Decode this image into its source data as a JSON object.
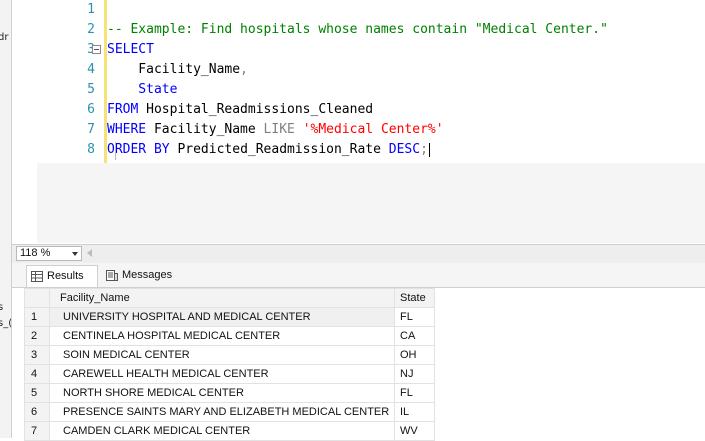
{
  "left_strip": {
    "top_text": "dr",
    "mid_text_1": "s",
    "mid_text_2": "s_("
  },
  "editor": {
    "lines": [
      {
        "num": "1",
        "parts": []
      },
      {
        "num": "2",
        "parts": [
          {
            "t": "-- Example: Find hospitals whose names contain \"Medical Center.\"",
            "c": "cm"
          }
        ]
      },
      {
        "num": "3",
        "parts": [
          {
            "t": "SELECT",
            "c": "kw"
          }
        ]
      },
      {
        "num": "4",
        "parts": [
          {
            "t": "    Facility_Name",
            "c": "id"
          },
          {
            "t": ",",
            "c": "op"
          }
        ]
      },
      {
        "num": "5",
        "parts": [
          {
            "t": "    State",
            "c": "kw"
          }
        ]
      },
      {
        "num": "6",
        "parts": [
          {
            "t": "FROM",
            "c": "kw"
          },
          {
            "t": " Hospital_Readmissions_Cleaned",
            "c": "id"
          }
        ]
      },
      {
        "num": "7",
        "parts": [
          {
            "t": "WHERE",
            "c": "kw"
          },
          {
            "t": " Facility_Name ",
            "c": "id"
          },
          {
            "t": "LIKE",
            "c": "op"
          },
          {
            "t": " ",
            "c": "id"
          },
          {
            "t": "'%Medical Center%'",
            "c": "str"
          }
        ]
      },
      {
        "num": "8",
        "parts": [
          {
            "t": "ORDER BY",
            "c": "kw"
          },
          {
            "t": " Predicted_Readmission_Rate ",
            "c": "id"
          },
          {
            "t": "DESC",
            "c": "kw"
          },
          {
            "t": ";",
            "c": "op"
          }
        ]
      }
    ]
  },
  "zoom": {
    "value": "118 %"
  },
  "tabs": {
    "results": "Results",
    "messages": "Messages"
  },
  "grid": {
    "headers": {
      "name": "Facility_Name",
      "state": "State"
    },
    "rows": [
      {
        "n": "1",
        "name": "UNIVERSITY HOSPITAL AND MEDICAL CENTER",
        "state": "FL"
      },
      {
        "n": "2",
        "name": "CENTINELA HOSPITAL MEDICAL CENTER",
        "state": "CA"
      },
      {
        "n": "3",
        "name": "SOIN MEDICAL CENTER",
        "state": "OH"
      },
      {
        "n": "4",
        "name": "CAREWELL HEALTH MEDICAL CENTER",
        "state": "NJ"
      },
      {
        "n": "5",
        "name": "NORTH SHORE MEDICAL CENTER",
        "state": "FL"
      },
      {
        "n": "6",
        "name": "PRESENCE SAINTS MARY AND ELIZABETH MEDICAL CENTER",
        "state": "IL"
      },
      {
        "n": "7",
        "name": "CAMDEN CLARK MEDICAL CENTER",
        "state": "WV"
      }
    ]
  },
  "colors": {
    "keyword": "#0000ff",
    "comment": "#008000",
    "string": "#ff0000",
    "line_number": "#2b91af",
    "change_bar": "#f5e37a"
  }
}
